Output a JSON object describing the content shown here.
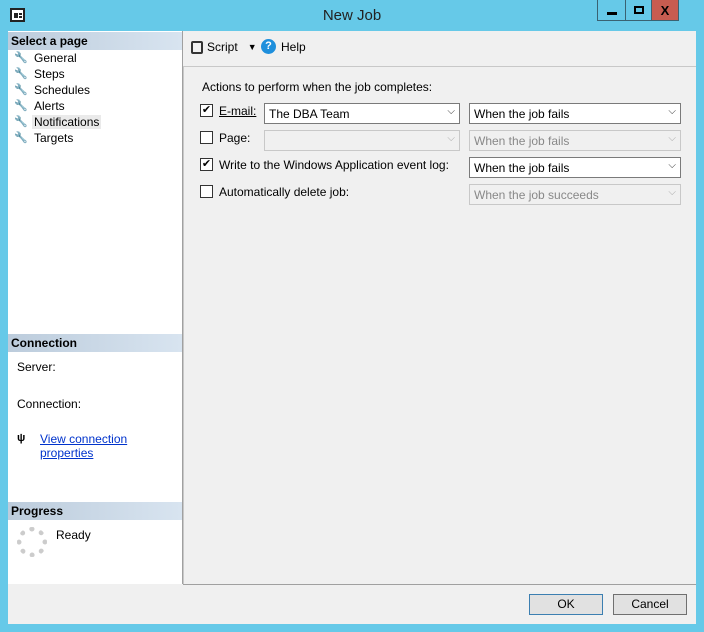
{
  "window": {
    "title": "New Job",
    "minimize": "▁",
    "maximize": "□",
    "close": "X"
  },
  "sidebar": {
    "select_header": "Select a page",
    "items": [
      {
        "label": "General"
      },
      {
        "label": "Steps"
      },
      {
        "label": "Schedules"
      },
      {
        "label": "Alerts"
      },
      {
        "label": "Notifications",
        "selected": true
      },
      {
        "label": "Targets"
      }
    ],
    "connection_header": "Connection",
    "server_label": "Server:",
    "connection_label": "Connection:",
    "view_link": "View connection properties",
    "progress_header": "Progress",
    "progress_status": "Ready"
  },
  "toolbar": {
    "script": "Script",
    "help": "Help"
  },
  "main": {
    "heading": "Actions to perform when the job completes:",
    "rows": [
      {
        "label": "E-mail:",
        "checked": true,
        "operator": "The DBA Team",
        "condition": "When the job fails"
      },
      {
        "label": "Page:",
        "checked": false,
        "operator": "",
        "condition": "When the job fails"
      },
      {
        "label": "Write to the Windows Application event log:",
        "checked": true,
        "condition": "When the job fails"
      },
      {
        "label": "Automatically delete job:",
        "checked": false,
        "condition": "When the job succeeds"
      }
    ]
  },
  "footer": {
    "ok": "OK",
    "cancel": "Cancel"
  }
}
